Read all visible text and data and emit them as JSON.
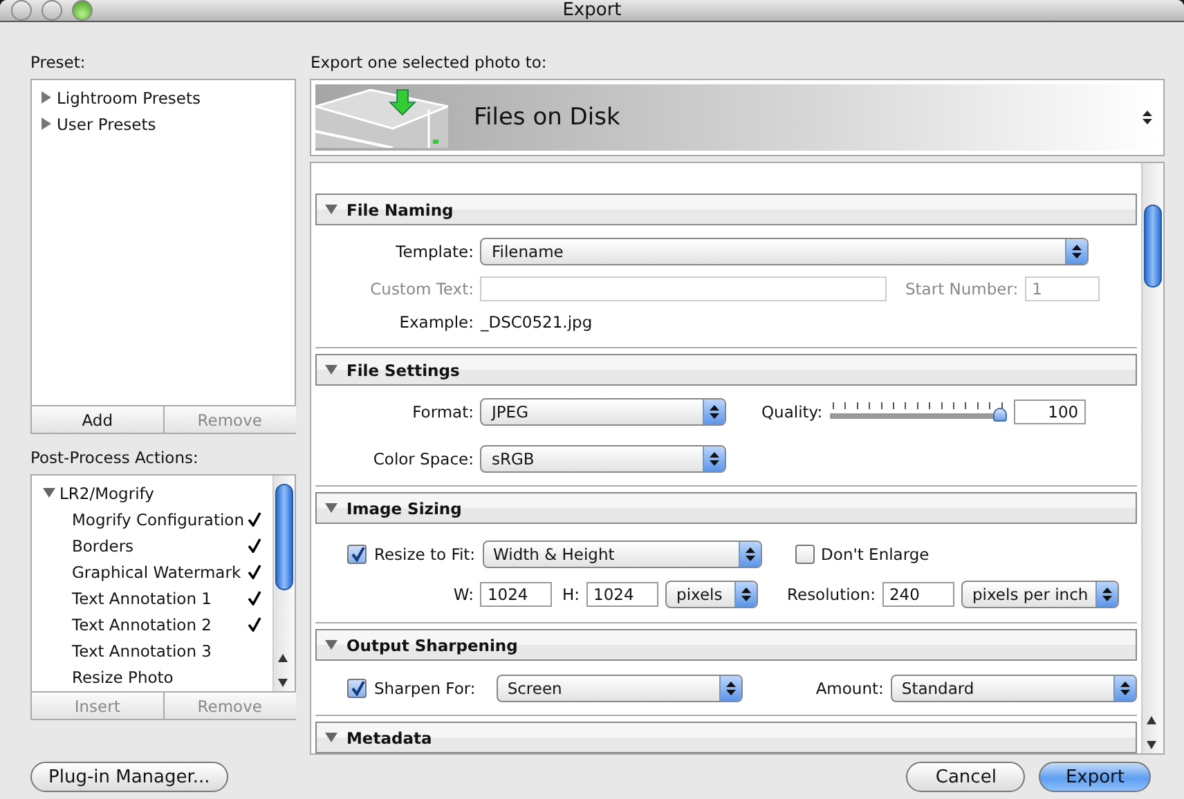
{
  "window": {
    "title": "Export"
  },
  "preset": {
    "label": "Preset:",
    "items": [
      {
        "label": "Lightroom Presets",
        "expanded": false
      },
      {
        "label": "User Presets",
        "expanded": false
      }
    ],
    "buttons": [
      {
        "label": "Add",
        "disabled": false
      },
      {
        "label": "Remove",
        "disabled": true
      }
    ]
  },
  "post_process": {
    "label": "Post-Process Actions:",
    "groups": [
      {
        "label": "LR2/Mogrify",
        "expanded": true,
        "children": [
          {
            "label": "Mogrify Configuration",
            "checked": true
          },
          {
            "label": "Borders",
            "checked": true
          },
          {
            "label": "Graphical Watermark",
            "checked": true
          },
          {
            "label": "Text Annotation 1",
            "checked": true
          },
          {
            "label": "Text Annotation 2",
            "checked": true
          },
          {
            "label": "Text Annotation 3",
            "checked": false
          },
          {
            "label": "Resize Photo",
            "checked": false
          }
        ]
      }
    ],
    "buttons": [
      {
        "label": "Insert",
        "disabled": true
      },
      {
        "label": "Remove",
        "disabled": true
      }
    ]
  },
  "export_to": {
    "label": "Export one selected photo to:",
    "destination": "Files on Disk"
  },
  "sections": [
    {
      "kind": "file_naming",
      "title": "File Naming",
      "expanded": true,
      "template": {
        "label": "Template:",
        "value": "Filename"
      },
      "custom_text": {
        "label": "Custom Text:",
        "disabled": true
      },
      "start_number": {
        "label": "Start Number:",
        "value": "1",
        "disabled": true
      },
      "example": {
        "label": "Example:",
        "value": "_DSC0521.jpg"
      }
    },
    {
      "kind": "file_settings",
      "title": "File Settings",
      "expanded": true,
      "format": {
        "label": "Format:",
        "value": "JPEG"
      },
      "quality": {
        "label": "Quality:",
        "level": 1,
        "value": "100"
      },
      "color_space": {
        "label": "Color Space:",
        "value": "sRGB"
      }
    },
    {
      "kind": "image_sizing",
      "title": "Image Sizing",
      "expanded": true,
      "resize": {
        "label": "Resize to Fit:",
        "checked": true,
        "value": "Width & Height"
      },
      "dont_enlarge": {
        "label": "Don't Enlarge",
        "checked": false
      },
      "width": {
        "label": "W:",
        "value": "1024"
      },
      "height": {
        "label": "H:",
        "value": "1024"
      },
      "units": "pixels",
      "resolution": {
        "label": "Resolution:",
        "value": "240",
        "units": "pixels per inch"
      }
    },
    {
      "kind": "output_sharpening",
      "title": "Output Sharpening",
      "expanded": true,
      "sharpen": {
        "label": "Sharpen For:",
        "checked": true,
        "value": "Screen"
      },
      "amount": {
        "label": "Amount:",
        "value": "Standard"
      }
    },
    {
      "kind": "metadata",
      "title": "Metadata",
      "expanded": true
    }
  ],
  "footer": {
    "plugin_manager": "Plug-in Manager...",
    "cancel": "Cancel",
    "export": "Export"
  }
}
